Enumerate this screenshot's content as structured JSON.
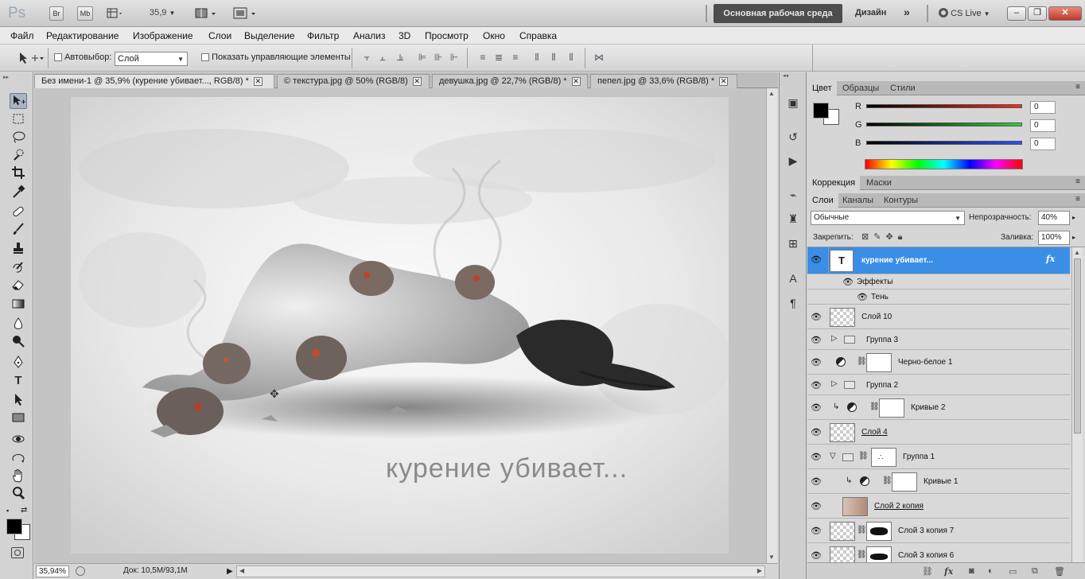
{
  "app": {
    "logo": "Ps",
    "zoom": "35,9",
    "workspace_active": "Основная рабочая среда",
    "workspace_design": "Дизайн",
    "cs_live": "CS Live",
    "br": "Br",
    "mb": "Mb"
  },
  "menu": [
    "Файл",
    "Редактирование",
    "Изображение",
    "Слои",
    "Выделение",
    "Фильтр",
    "Анализ",
    "3D",
    "Просмотр",
    "Окно",
    "Справка"
  ],
  "options": {
    "autoselect_label": "Автовыбор:",
    "autoselect_value": "Слой",
    "show_controls_label": "Показать управляющие элементы"
  },
  "tabs": [
    {
      "label": "Без имени-1 @ 35,9% (курение убивает..., RGB/8) *"
    },
    {
      "label": "© текстура.jpg @ 50% (RGB/8)"
    },
    {
      "label": "девушка.jpg @ 22,7% (RGB/8) *"
    },
    {
      "label": "пепел.jpg @ 33,6% (RGB/8) *"
    }
  ],
  "canvas": {
    "caption": "курение убивает..."
  },
  "status": {
    "zoom": "35,94%",
    "doc": "Док: 10,5M/93,1M"
  },
  "color_panel": {
    "tabs": [
      "Цвет",
      "Образцы",
      "Стили"
    ],
    "channels": [
      {
        "name": "R",
        "value": "0",
        "color": "#c9302c"
      },
      {
        "name": "G",
        "value": "0",
        "color": "#3ea33a"
      },
      {
        "name": "B",
        "value": "0",
        "color": "#2f4fc9"
      }
    ]
  },
  "adjust_panel": {
    "tabs": [
      "Коррекция",
      "Маски"
    ]
  },
  "layers_panel": {
    "tabs": [
      "Слои",
      "Каналы",
      "Контуры"
    ],
    "blend_mode": "Обычные",
    "opacity_label": "Непрозрачность:",
    "opacity": "40%",
    "lock_label": "Закрепить:",
    "fill_label": "Заливка:",
    "fill": "100%",
    "layers": [
      {
        "name": "курение убивает...",
        "selected": true,
        "fx": "fx",
        "type_glyph": "T"
      },
      {
        "name": "Эффекты"
      },
      {
        "name": "Тень"
      },
      {
        "name": "Слой 10"
      },
      {
        "name": "Группа 3"
      },
      {
        "name": "Черно-белое 1"
      },
      {
        "name": "Группа 2"
      },
      {
        "name": "Кривые 2"
      },
      {
        "name": "Слой 4"
      },
      {
        "name": "Группа 1"
      },
      {
        "name": "Кривые 1"
      },
      {
        "name": "Слой 2 копия"
      },
      {
        "name": "Слой 3 копия 7"
      },
      {
        "name": "Слой 3 копия 6"
      }
    ]
  },
  "colors": {
    "selection": "#3a8ee6",
    "accent_dark": "#4d4d4d"
  }
}
